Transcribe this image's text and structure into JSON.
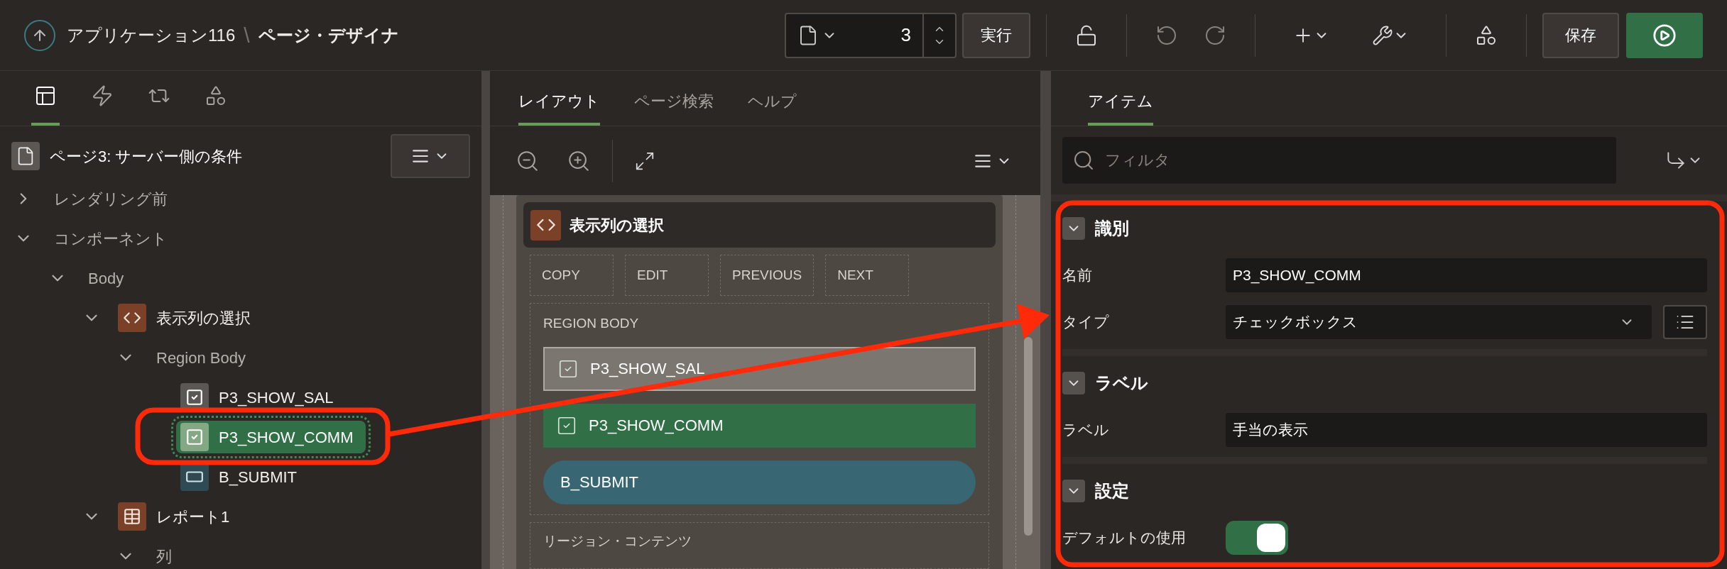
{
  "header": {
    "app": "アプリケーション116",
    "separator": "\\",
    "title": "ページ・デザイナ"
  },
  "toolbar": {
    "page_number": "3",
    "run_label": "実行",
    "save_label": "保存"
  },
  "left_panel": {
    "tabs": [
      {
        "kind": "rendering",
        "selected": true
      },
      {
        "kind": "dynamic_actions",
        "selected": false
      },
      {
        "kind": "processing",
        "selected": false
      },
      {
        "kind": "shared",
        "selected": false
      }
    ],
    "page_title": "ページ3: サーバー側の条件",
    "tree": [
      {
        "label": "レンダリング前",
        "expanded": false
      },
      {
        "label": "コンポーネント",
        "expanded": true,
        "children": [
          {
            "label": "Body",
            "expanded": true,
            "children": [
              {
                "label": "表示列の選択",
                "kind": "region",
                "expanded": true,
                "children": [
                  {
                    "label": "Region Body",
                    "expanded": true,
                    "children": [
                      {
                        "label": "P3_SHOW_SAL",
                        "kind": "checkbox",
                        "selected": false
                      },
                      {
                        "label": "P3_SHOW_COMM",
                        "kind": "checkbox",
                        "selected": true
                      },
                      {
                        "label": "B_SUBMIT",
                        "kind": "button",
                        "selected": false
                      }
                    ]
                  }
                ]
              },
              {
                "label": "レポート1",
                "kind": "report",
                "expanded": true,
                "children": [
                  {
                    "label": "列",
                    "expanded": true
                  }
                ]
              }
            ]
          }
        ]
      }
    ]
  },
  "middle_panel": {
    "tabs": [
      {
        "label": "レイアウト",
        "selected": true
      },
      {
        "label": "ページ検索",
        "selected": false
      },
      {
        "label": "ヘルプ",
        "selected": false
      }
    ],
    "region": {
      "title": "表示列の選択",
      "buttons": [
        "COPY",
        "EDIT",
        "PREVIOUS",
        "NEXT"
      ],
      "body_label": "REGION BODY",
      "items": [
        {
          "label": "P3_SHOW_SAL",
          "kind": "checkbox",
          "selected": false
        },
        {
          "label": "P3_SHOW_COMM",
          "kind": "checkbox",
          "selected": true
        },
        {
          "label": "B_SUBMIT",
          "kind": "button",
          "selected": false
        }
      ],
      "next_label": "リージョン・コンテンツ"
    }
  },
  "right_panel": {
    "tabs": [
      {
        "label": "アイテム",
        "selected": true
      }
    ],
    "filter": {
      "placeholder": "フィルタ"
    },
    "groups": [
      {
        "title": "識別",
        "expanded": true,
        "properties": [
          {
            "label": "名前",
            "kind": "text",
            "value": "P3_SHOW_COMM"
          },
          {
            "label": "タイプ",
            "kind": "select",
            "value": "チェックボックス"
          }
        ]
      },
      {
        "title": "ラベル",
        "expanded": true,
        "properties": [
          {
            "label": "ラベル",
            "kind": "text",
            "value": "手当の表示"
          }
        ]
      },
      {
        "title": "設定",
        "expanded": true,
        "properties": [
          {
            "label": "デフォルトの使用",
            "kind": "switch",
            "on": true
          }
        ]
      }
    ]
  }
}
